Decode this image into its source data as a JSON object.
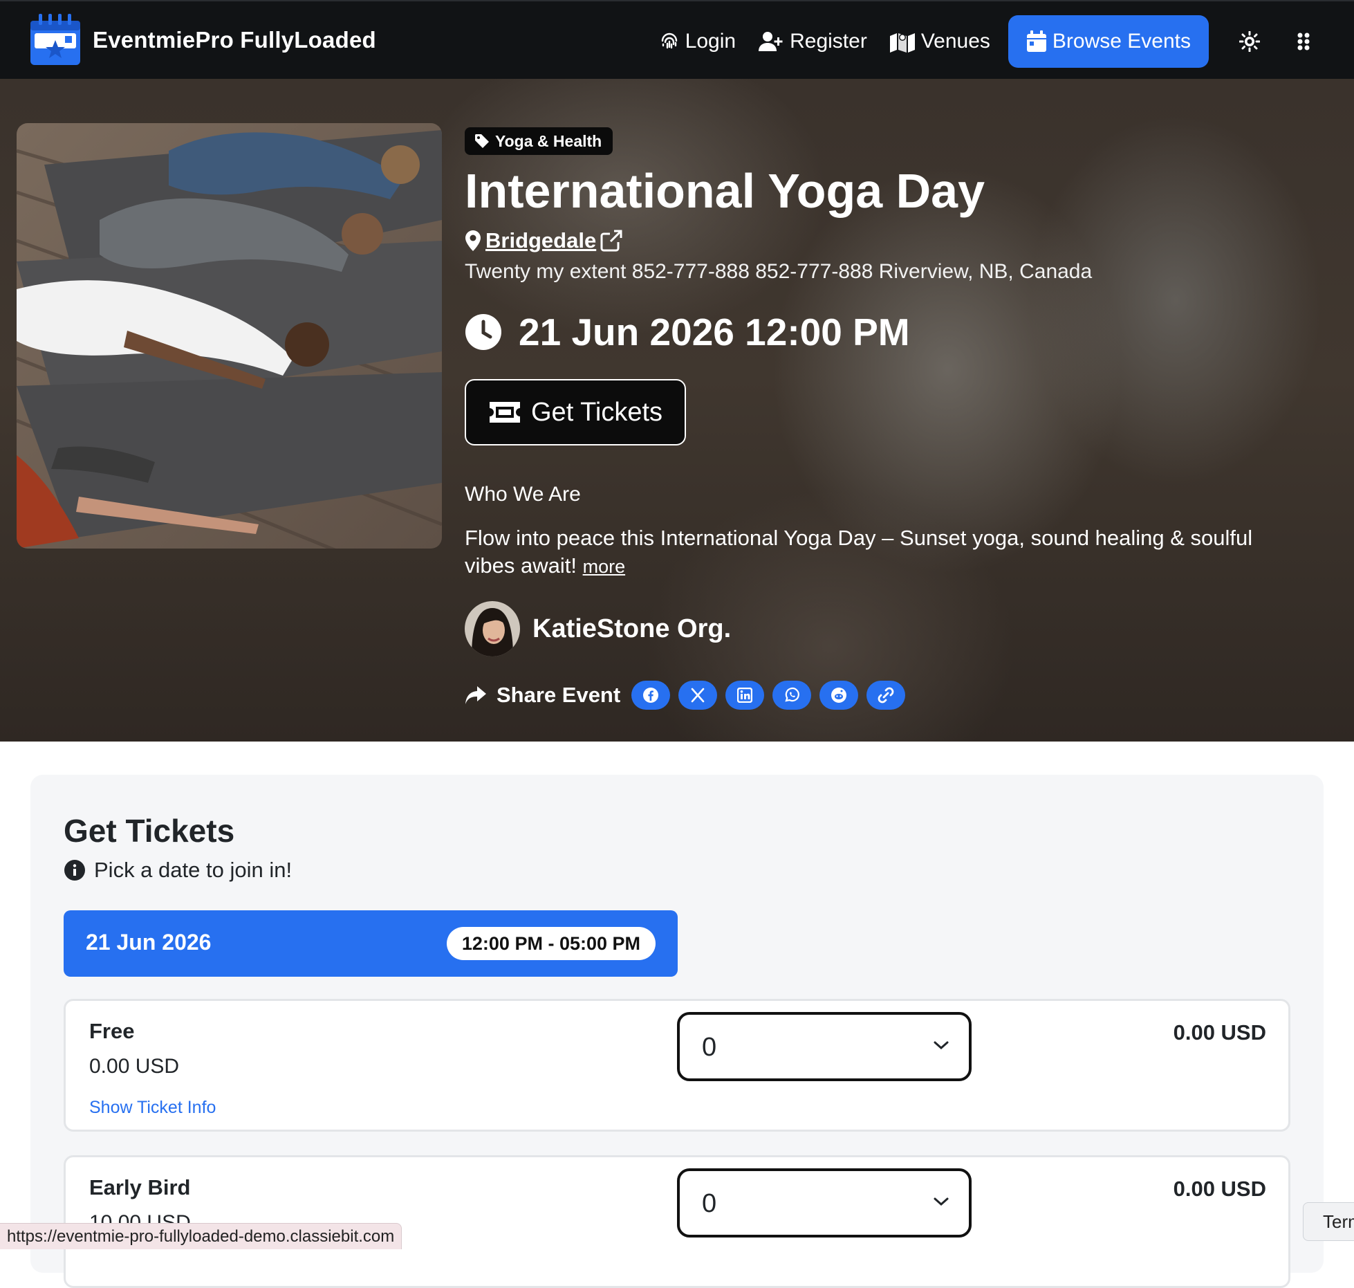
{
  "navbar": {
    "brand": "EventmiePro FullyLoaded",
    "login": "Login",
    "register": "Register",
    "venues": "Venues",
    "browse_events": "Browse Events"
  },
  "hero": {
    "category": "Yoga & Health",
    "title": "International Yoga Day",
    "venue": "Bridgedale",
    "address": "Twenty my extent 852-777-888 852-777-888 Riverview, NB, Canada",
    "datetime": "21 Jun 2026 12:00 PM",
    "get_tickets": "Get Tickets",
    "who_heading": "Who We Are",
    "description": "Flow into peace this International Yoga Day – Sunset yoga, sound healing & soulful vibes await!",
    "more": "more",
    "organizer": "KatieStone Org.",
    "share_label": "Share Event",
    "share_icons": [
      "facebook-icon",
      "x-icon",
      "linkedin-icon",
      "whatsapp-icon",
      "reddit-icon",
      "link-icon"
    ]
  },
  "tickets": {
    "title": "Get Tickets",
    "subtitle": "Pick a date to join in!",
    "date": "21 Jun 2026",
    "time_range": "12:00 PM - 05:00 PM",
    "items": [
      {
        "name": "Free",
        "price": "0.00 USD",
        "info": "Show Ticket Info",
        "qty": "0",
        "total": "0.00 USD"
      },
      {
        "name": "Early Bird",
        "price": "10.00 USD",
        "info": "",
        "qty": "0",
        "total": "0.00 USD"
      }
    ]
  },
  "status_bar": {
    "url": "https://eventmie-pro-fullyloaded-demo.classiebit.com"
  },
  "terms_tab": "Terms",
  "colors": {
    "primary": "#2770f0",
    "navbar": "#111315",
    "panel": "#f5f6f8"
  }
}
